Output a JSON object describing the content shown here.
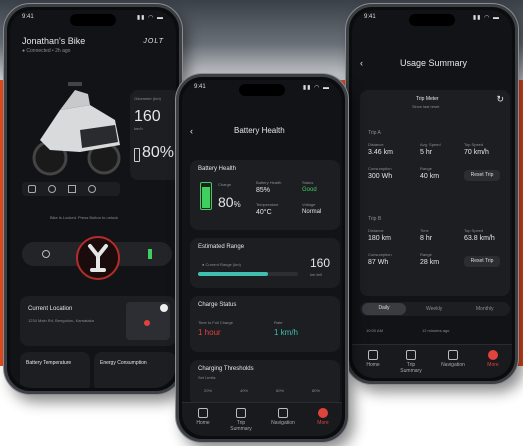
{
  "phone_left": {
    "status_time": "9:41",
    "status_icons": "▮▮ ◠ ▬",
    "bike_name": "Jonathan's Bike",
    "bike_sub": "● Connected • 2h ago",
    "brand": "JOLT",
    "odometer_label": "Odometer (km)",
    "speed_value": "160",
    "speed_unit": "km/h",
    "battery_value": "80%",
    "quick_label": "Bike is Locked. Press Button to unlock",
    "location_title": "Current Location",
    "location_text": "1234 Main Rd, Bengaluru, Karnataka",
    "tile1": "Battery Temperature",
    "tile2": "Energy Consumption"
  },
  "phone_mid": {
    "status_time": "9:41",
    "status_icons": "▮▮ ◠ ▬",
    "title": "Battery Health",
    "health_title": "Battery Health",
    "charge_label": "Charge",
    "battery_pct": "80",
    "pct_sign": "%",
    "stat1_label": "Battery Health",
    "stat1_value": "85%",
    "stat2_label": "Status",
    "stat2_value": "Good",
    "stat3_label": "Temperature",
    "stat3_value": "40°C",
    "stat4_label": "Voltage",
    "stat4_value": "Normal",
    "range_title": "Estimated Range",
    "range_mode": "● Current Range (km)",
    "range_value": "160",
    "range_unit": "km left",
    "range_fraction": 0.7,
    "charge_title": "Charge Status",
    "charge_time_label": "Time to Full Charge",
    "charge_time": "1 hour",
    "charge_rate_label": "Rate",
    "charge_rate": "1 km/h",
    "thresholds_title": "Charging Thresholds",
    "thresholds_sub": "Set Limits",
    "threshold_ticks": [
      "20%",
      "40%",
      "60%",
      "80%"
    ],
    "nav": [
      "Home",
      "Trip Summary",
      "Navigation",
      "More"
    ],
    "accent": "#e0433c",
    "good_color": "#3ecf5e"
  },
  "phone_right": {
    "status_time": "9:41",
    "status_icons": "▮▮ ◠ ▬",
    "title": "Usage Summary",
    "trip_meter_title": "Trip Meter",
    "trip_meter_sub": "Since last reset",
    "trip_a": {
      "name": "Trip A",
      "cells": [
        {
          "label": "Distance",
          "value": "3.46 km"
        },
        {
          "label": "Avg. Speed",
          "value": "5 hr"
        },
        {
          "label": "Top Speed",
          "value": "70 km/h"
        },
        {
          "label": "Consumption",
          "value": "300 Wh"
        },
        {
          "label": "Range",
          "value": "40 km"
        }
      ],
      "reset": "Reset Trip"
    },
    "trip_b": {
      "name": "Trip B",
      "cells": [
        {
          "label": "Distance",
          "value": "180 km"
        },
        {
          "label": "Time",
          "value": "8 hr"
        },
        {
          "label": "Top Speed",
          "value": "63.8 km/h"
        },
        {
          "label": "Consumption",
          "value": "87 Wh"
        },
        {
          "label": "Range",
          "value": "28 km"
        }
      ],
      "reset": "Reset Trip"
    },
    "tabs": [
      "Daily",
      "Weekly",
      "Monthly"
    ],
    "footer_left": "10:00 AM",
    "footer_right": "12 minutes ago",
    "nav": [
      "Home",
      "Trip Summary",
      "Navigation",
      "More"
    ]
  }
}
